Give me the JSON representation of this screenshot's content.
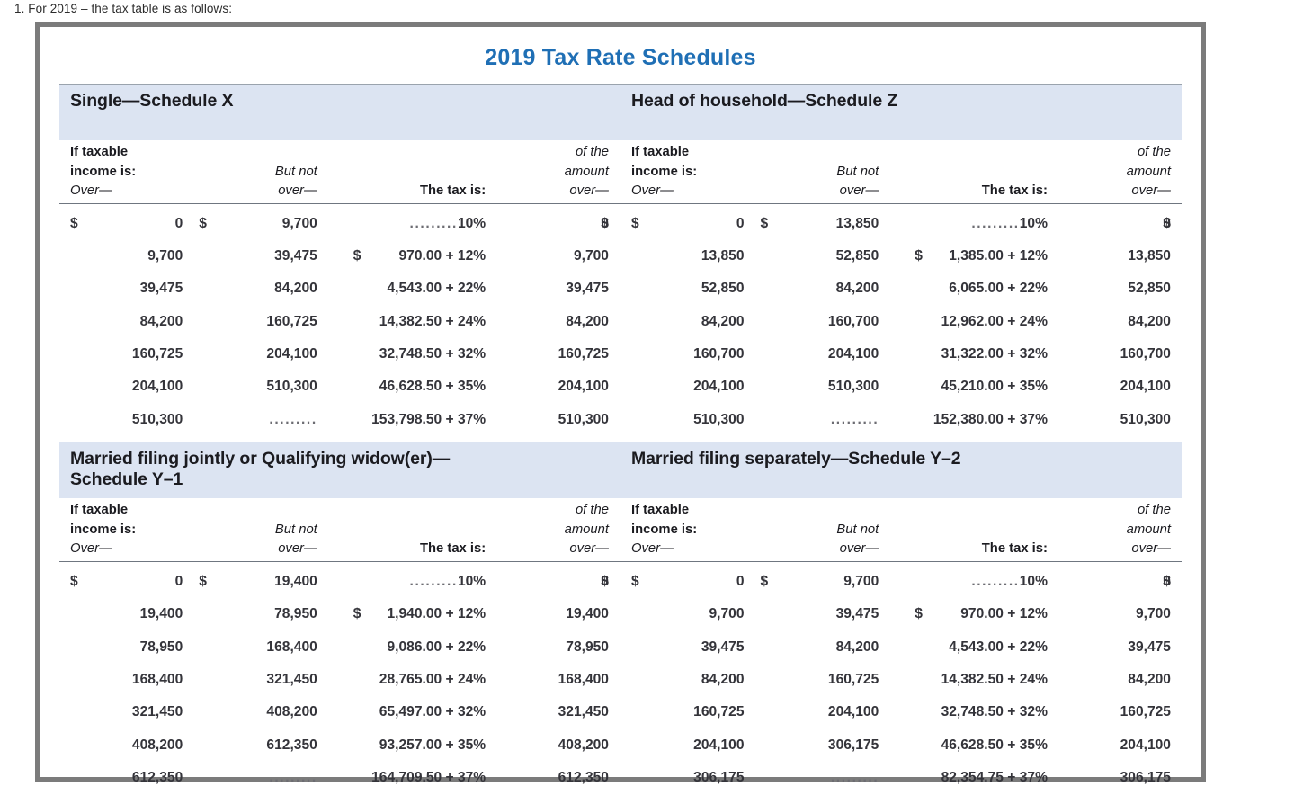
{
  "intro_text": "1. For 2019 – the tax table is as follows:",
  "figure": {
    "title": "2019 Tax Rate Schedules",
    "accent_color": "#1f6fb5",
    "band_color": "#dce4f2",
    "frame_color": "#7b7b7b"
  },
  "column_headers": {
    "line1_c1": "If taxable",
    "line1_c4": "of the",
    "line2_c1": "income is:",
    "line2_c2": "But not",
    "line2_c4": "amount",
    "line3_c1": "Over—",
    "line3_c2": "over—",
    "line3_c3": "The tax is:",
    "line3_c4": "over—"
  },
  "leader_dots": ".........",
  "schedules": [
    {
      "id": "single",
      "heading": "Single—Schedule X",
      "rows": [
        {
          "over_sign": "$",
          "over": "0",
          "butnot_sign": "$",
          "butnot": "9,700",
          "tax_sign": "",
          "tax": ".........10%",
          "amount_sign": "$",
          "amount": "0"
        },
        {
          "over_sign": "",
          "over": "9,700",
          "butnot_sign": "",
          "butnot": "39,475",
          "tax_sign": "$",
          "tax": "970.00 + 12%",
          "amount_sign": "",
          "amount": "9,700"
        },
        {
          "over_sign": "",
          "over": "39,475",
          "butnot_sign": "",
          "butnot": "84,200",
          "tax_sign": "",
          "tax": "4,543.00 + 22%",
          "amount_sign": "",
          "amount": "39,475"
        },
        {
          "over_sign": "",
          "over": "84,200",
          "butnot_sign": "",
          "butnot": "160,725",
          "tax_sign": "",
          "tax": "14,382.50 + 24%",
          "amount_sign": "",
          "amount": "84,200"
        },
        {
          "over_sign": "",
          "over": "160,725",
          "butnot_sign": "",
          "butnot": "204,100",
          "tax_sign": "",
          "tax": "32,748.50 + 32%",
          "amount_sign": "",
          "amount": "160,725"
        },
        {
          "over_sign": "",
          "over": "204,100",
          "butnot_sign": "",
          "butnot": "510,300",
          "tax_sign": "",
          "tax": "46,628.50 + 35%",
          "amount_sign": "",
          "amount": "204,100"
        },
        {
          "over_sign": "",
          "over": "510,300",
          "butnot_sign": "",
          "butnot": ".........",
          "tax_sign": "",
          "tax": "153,798.50 + 37%",
          "amount_sign": "",
          "amount": "510,300"
        }
      ]
    },
    {
      "id": "head-of-household",
      "heading": "Head of household—Schedule Z",
      "rows": [
        {
          "over_sign": "$",
          "over": "0",
          "butnot_sign": "$",
          "butnot": "13,850",
          "tax_sign": "",
          "tax": ".........10%",
          "amount_sign": "$",
          "amount": "0"
        },
        {
          "over_sign": "",
          "over": "13,850",
          "butnot_sign": "",
          "butnot": "52,850",
          "tax_sign": "$",
          "tax": "1,385.00 + 12%",
          "amount_sign": "",
          "amount": "13,850"
        },
        {
          "over_sign": "",
          "over": "52,850",
          "butnot_sign": "",
          "butnot": "84,200",
          "tax_sign": "",
          "tax": "6,065.00 + 22%",
          "amount_sign": "",
          "amount": "52,850"
        },
        {
          "over_sign": "",
          "over": "84,200",
          "butnot_sign": "",
          "butnot": "160,700",
          "tax_sign": "",
          "tax": "12,962.00 + 24%",
          "amount_sign": "",
          "amount": "84,200"
        },
        {
          "over_sign": "",
          "over": "160,700",
          "butnot_sign": "",
          "butnot": "204,100",
          "tax_sign": "",
          "tax": "31,322.00 + 32%",
          "amount_sign": "",
          "amount": "160,700"
        },
        {
          "over_sign": "",
          "over": "204,100",
          "butnot_sign": "",
          "butnot": "510,300",
          "tax_sign": "",
          "tax": "45,210.00 + 35%",
          "amount_sign": "",
          "amount": "204,100"
        },
        {
          "over_sign": "",
          "over": "510,300",
          "butnot_sign": "",
          "butnot": ".........",
          "tax_sign": "",
          "tax": "152,380.00 + 37%",
          "amount_sign": "",
          "amount": "510,300"
        }
      ]
    },
    {
      "id": "married-filing-jointly",
      "heading": "Married filing jointly or Qualifying widow(er)—\nSchedule Y–1",
      "rows": [
        {
          "over_sign": "$",
          "over": "0",
          "butnot_sign": "$",
          "butnot": "19,400",
          "tax_sign": "",
          "tax": ".........10%",
          "amount_sign": "$",
          "amount": "0"
        },
        {
          "over_sign": "",
          "over": "19,400",
          "butnot_sign": "",
          "butnot": "78,950",
          "tax_sign": "$",
          "tax": "1,940.00 + 12%",
          "amount_sign": "",
          "amount": "19,400"
        },
        {
          "over_sign": "",
          "over": "78,950",
          "butnot_sign": "",
          "butnot": "168,400",
          "tax_sign": "",
          "tax": "9,086.00 + 22%",
          "amount_sign": "",
          "amount": "78,950"
        },
        {
          "over_sign": "",
          "over": "168,400",
          "butnot_sign": "",
          "butnot": "321,450",
          "tax_sign": "",
          "tax": "28,765.00 + 24%",
          "amount_sign": "",
          "amount": "168,400"
        },
        {
          "over_sign": "",
          "over": "321,450",
          "butnot_sign": "",
          "butnot": "408,200",
          "tax_sign": "",
          "tax": "65,497.00 + 32%",
          "amount_sign": "",
          "amount": "321,450"
        },
        {
          "over_sign": "",
          "over": "408,200",
          "butnot_sign": "",
          "butnot": "612,350",
          "tax_sign": "",
          "tax": "93,257.00 + 35%",
          "amount_sign": "",
          "amount": "408,200"
        },
        {
          "over_sign": "",
          "over": "612,350",
          "butnot_sign": "",
          "butnot": ".........",
          "tax_sign": "",
          "tax": "164,709.50 + 37%",
          "amount_sign": "",
          "amount": "612,350"
        }
      ]
    },
    {
      "id": "married-filing-separately",
      "heading": "Married filing separately—Schedule Y–2",
      "rows": [
        {
          "over_sign": "$",
          "over": "0",
          "butnot_sign": "$",
          "butnot": "9,700",
          "tax_sign": "",
          "tax": ".........10%",
          "amount_sign": "$",
          "amount": "0"
        },
        {
          "over_sign": "",
          "over": "9,700",
          "butnot_sign": "",
          "butnot": "39,475",
          "tax_sign": "$",
          "tax": "970.00 + 12%",
          "amount_sign": "",
          "amount": "9,700"
        },
        {
          "over_sign": "",
          "over": "39,475",
          "butnot_sign": "",
          "butnot": "84,200",
          "tax_sign": "",
          "tax": "4,543.00 + 22%",
          "amount_sign": "",
          "amount": "39,475"
        },
        {
          "over_sign": "",
          "over": "84,200",
          "butnot_sign": "",
          "butnot": "160,725",
          "tax_sign": "",
          "tax": "14,382.50 + 24%",
          "amount_sign": "",
          "amount": "84,200"
        },
        {
          "over_sign": "",
          "over": "160,725",
          "butnot_sign": "",
          "butnot": "204,100",
          "tax_sign": "",
          "tax": "32,748.50 + 32%",
          "amount_sign": "",
          "amount": "160,725"
        },
        {
          "over_sign": "",
          "over": "204,100",
          "butnot_sign": "",
          "butnot": "306,175",
          "tax_sign": "",
          "tax": "46,628.50 + 35%",
          "amount_sign": "",
          "amount": "204,100"
        },
        {
          "over_sign": "",
          "over": "306,175",
          "butnot_sign": "",
          "butnot": ".........",
          "tax_sign": "",
          "tax": "82,354.75 + 37%",
          "amount_sign": "",
          "amount": "306,175"
        }
      ]
    }
  ]
}
